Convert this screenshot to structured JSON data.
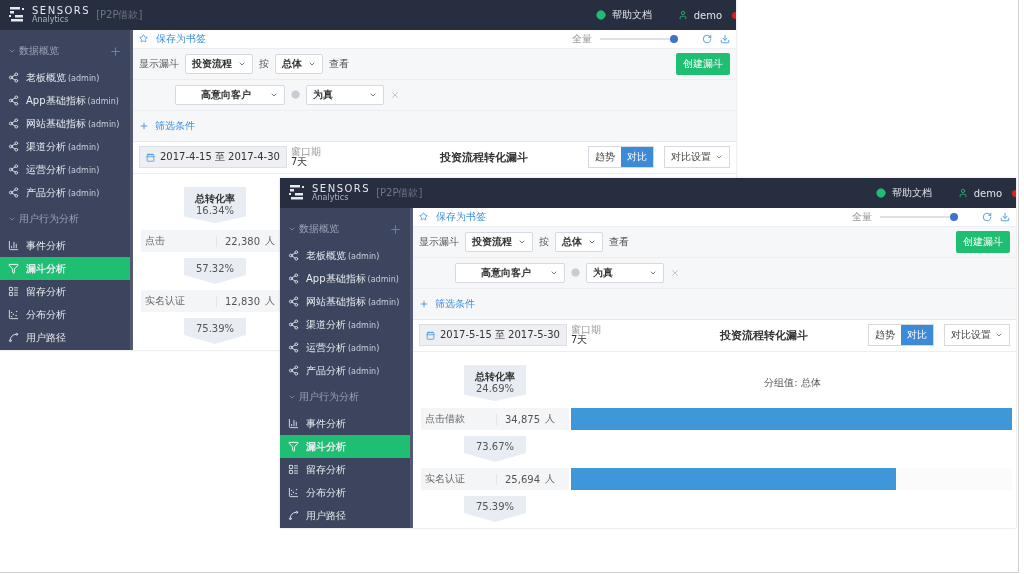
{
  "windows": [
    {
      "brand": {
        "name": "SENSORS",
        "sub": "Analytics",
        "project": "[P2P借款]"
      },
      "help": "帮助文档",
      "user": "demo",
      "sidebar": [
        {
          "title": "数据概览",
          "addable": true,
          "items": [
            {
              "label": "老板概览",
              "tag": "(admin)",
              "kind": "share",
              "selected": false
            },
            {
              "label": "App基础指标",
              "tag": "(admin)",
              "kind": "share",
              "selected": false
            },
            {
              "label": "网站基础指标",
              "tag": "(admin)",
              "kind": "share",
              "selected": false
            },
            {
              "label": "渠道分析",
              "tag": "(admin)",
              "kind": "share",
              "selected": false
            },
            {
              "label": "运营分析",
              "tag": "(admin)",
              "kind": "share",
              "selected": false
            },
            {
              "label": "产品分析",
              "tag": "(admin)",
              "kind": "share",
              "selected": false
            }
          ]
        },
        {
          "title": "用户行为分析",
          "addable": false,
          "items": [
            {
              "label": "事件分析",
              "kind": "bars",
              "selected": false
            },
            {
              "label": "漏斗分析",
              "kind": "funnel",
              "selected": true
            },
            {
              "label": "留存分析",
              "kind": "retention",
              "selected": false
            },
            {
              "label": "分布分析",
              "kind": "scatter",
              "selected": false
            },
            {
              "label": "用户路径",
              "kind": "path",
              "selected": false
            }
          ]
        }
      ],
      "bookmark": "保存为书签",
      "scope": {
        "label": "全量",
        "level": 1
      },
      "filters": {
        "label": "显示漏斗",
        "funnel": "投资流程",
        "by": "按",
        "group": "总体",
        "view": "查看",
        "create": "创建漏斗",
        "condition": "高意向客户",
        "value": "为真",
        "add": "筛选条件"
      },
      "date": {
        "range": "2017-4-15 至 2017-4-30",
        "window_label": "窗口期",
        "window_value": "7天"
      },
      "title": "投资流程转化漏斗",
      "modes": [
        {
          "label": "趋势",
          "selected": false
        },
        {
          "label": "对比",
          "selected": true
        }
      ],
      "compare": "对比设置",
      "funnel": {
        "total_label": "总转化率",
        "total": "16.34%",
        "steps": [
          {
            "label": "点击",
            "count": "22,380",
            "unit": "人",
            "rate": "57.32%"
          },
          {
            "label": "实名认证",
            "count": "12,830",
            "unit": "人",
            "rate": "75.39%"
          }
        ]
      }
    },
    {
      "brand": {
        "name": "SENSORS",
        "sub": "Analytics",
        "project": "[P2P借款]"
      },
      "help": "帮助文档",
      "user": "demo",
      "sidebar": [
        {
          "title": "数据概览",
          "addable": true,
          "items": [
            {
              "label": "老板概览",
              "tag": "(admin)",
              "kind": "share",
              "selected": false
            },
            {
              "label": "App基础指标",
              "tag": "(admin)",
              "kind": "share",
              "selected": false
            },
            {
              "label": "网站基础指标",
              "tag": "(admin)",
              "kind": "share",
              "selected": false
            },
            {
              "label": "渠道分析",
              "tag": "(admin)",
              "kind": "share",
              "selected": false
            },
            {
              "label": "运营分析",
              "tag": "(admin)",
              "kind": "share",
              "selected": false
            },
            {
              "label": "产品分析",
              "tag": "(admin)",
              "kind": "share",
              "selected": false
            }
          ]
        },
        {
          "title": "用户行为分析",
          "addable": false,
          "items": [
            {
              "label": "事件分析",
              "kind": "bars",
              "selected": false
            },
            {
              "label": "漏斗分析",
              "kind": "funnel",
              "selected": true
            },
            {
              "label": "留存分析",
              "kind": "retention",
              "selected": false
            },
            {
              "label": "分布分析",
              "kind": "scatter",
              "selected": false
            },
            {
              "label": "用户路径",
              "kind": "path",
              "selected": false
            }
          ]
        }
      ],
      "bookmark": "保存为书签",
      "scope": {
        "label": "全量",
        "level": 1
      },
      "filters": {
        "label": "显示漏斗",
        "funnel": "投资流程",
        "by": "按",
        "group": "总体",
        "view": "查看",
        "create": "创建漏斗",
        "condition": "高意向客户",
        "value": "为真",
        "add": "筛选条件"
      },
      "date": {
        "range": "2017-5-15 至 2017-5-30",
        "window_label": "窗口期",
        "window_value": "7天"
      },
      "title": "投资流程转化漏斗",
      "modes": [
        {
          "label": "趋势",
          "selected": false
        },
        {
          "label": "对比",
          "selected": true
        }
      ],
      "compare": "对比设置",
      "funnel": {
        "total_label": "总转化率",
        "total": "24.69%",
        "group_value": "分组值: 总体",
        "steps": [
          {
            "label": "点击借款",
            "count": "34,875",
            "unit": "人",
            "level": 1,
            "rate": "73.67%"
          },
          {
            "label": "实名认证",
            "count": "25,694",
            "unit": "人",
            "level": 0.737,
            "rate": "75.39%"
          }
        ]
      }
    }
  ]
}
